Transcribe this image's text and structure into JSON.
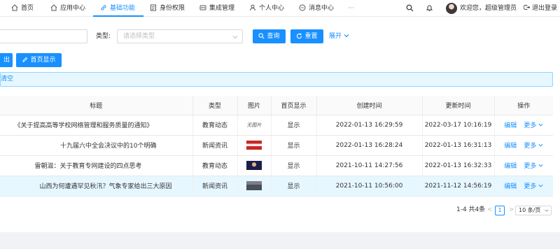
{
  "colors": {
    "primary": "#1890ff",
    "alert_bg": "#e6f7ff",
    "header_bg": "#ffffff"
  },
  "nav": {
    "items": [
      {
        "label": "首页",
        "icon": "home-icon"
      },
      {
        "label": "应用中心",
        "icon": "app-icon"
      },
      {
        "label": "基础功能",
        "icon": "link-icon",
        "active": true
      },
      {
        "label": "身份权限",
        "icon": "id-icon"
      },
      {
        "label": "集成管理",
        "icon": "integration-icon"
      },
      {
        "label": "个人中心",
        "icon": "user-icon"
      },
      {
        "label": "消息中心",
        "icon": "message-icon"
      }
    ],
    "more": "···",
    "welcome": "欢迎您，超级管理员",
    "logout": "退出登录"
  },
  "search": {
    "type_label": "类型:",
    "type_placeholder": "请选择类型",
    "query_label": "查询",
    "reset_label": "重置",
    "expand_label": "展开"
  },
  "toolbar": {
    "export_label": "出",
    "homepage_label": "首页显示"
  },
  "alert": {
    "text": "清空"
  },
  "table": {
    "headers": [
      "标题",
      "类型",
      "图片",
      "首页显示",
      "创建时间",
      "更新时间",
      "操作"
    ],
    "rows": [
      {
        "title": "《关于提高高等学校网络管理和服务质量的通知》",
        "type": "教育动态",
        "image_text": "无图片",
        "show": "显示",
        "created": "2022-01-13 16:29:59",
        "updated": "2022-03-17 10:16:19",
        "edit": "编辑",
        "more": "更多"
      },
      {
        "title": "十九届六中全会决议中的10个明确",
        "type": "新闻资讯",
        "image_text": "",
        "show": "显示",
        "created": "2022-01-13 16:28:24",
        "updated": "2022-01-13 16:31:13",
        "edit": "编辑",
        "more": "更多"
      },
      {
        "title": "雷朝滋：关于教育专网建设的四点思考",
        "type": "教育动态",
        "image_text": "",
        "show": "显示",
        "created": "2021-10-11 14:27:56",
        "updated": "2022-01-13 16:32:33",
        "edit": "编辑",
        "more": "更多"
      },
      {
        "title": "山西为何遭遇罕见秋汛？气象专家给出三大原因",
        "type": "新闻资讯",
        "image_text": "",
        "show": "显示",
        "created": "2021-10-11 10:56:00",
        "updated": "2021-11-12 14:56:19",
        "edit": "编辑",
        "more": "更多"
      }
    ]
  },
  "pagination": {
    "summary": "1-4 共4条",
    "prev": "<",
    "current": "1",
    "next": ">",
    "page_size": "10 条/页"
  }
}
